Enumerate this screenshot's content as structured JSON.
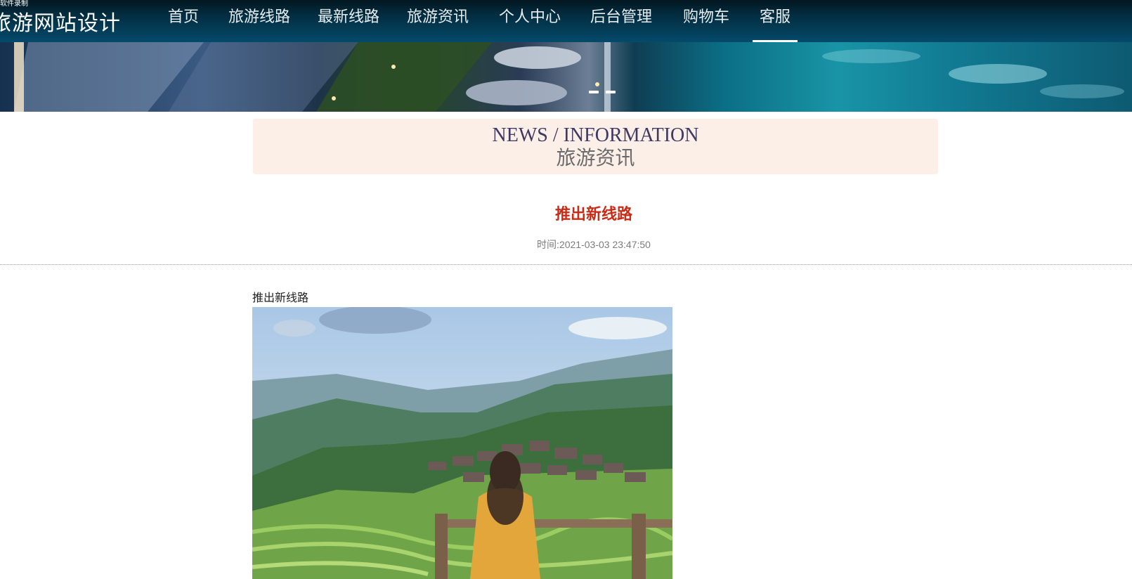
{
  "watermark": "软件录制",
  "brand": "旅游网站设计",
  "nav": {
    "items": [
      {
        "label": "首页"
      },
      {
        "label": "旅游线路"
      },
      {
        "label": "最新线路"
      },
      {
        "label": "旅游资讯"
      },
      {
        "label": "个人中心"
      },
      {
        "label": "后台管理"
      },
      {
        "label": "购物车"
      },
      {
        "label": "客服"
      }
    ],
    "active": "客服"
  },
  "section": {
    "title_en": "NEWS / INFORMATION",
    "title_cn": "旅游资讯"
  },
  "article": {
    "title": "推出新线路",
    "time_label": "时间:",
    "time_value": "2021-03-03 23:47:50",
    "content": "推出新线路"
  },
  "colors": {
    "nav_bg": "#044a6b",
    "section_bg": "#fcefe8",
    "title_red": "#cc2a14",
    "heading_navy": "#3e3a63"
  }
}
